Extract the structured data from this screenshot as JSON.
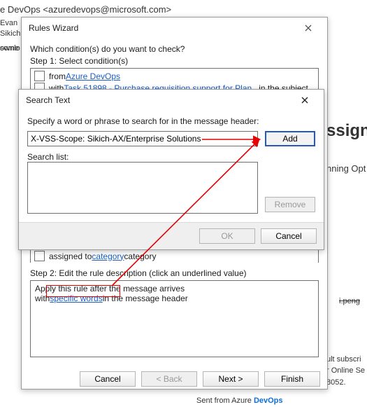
{
  "bg": {
    "from_line": "e DevOps <azuredevops@microsoft.com>",
    "evan": "Evan",
    "sikich": "Sikich",
    "ownlo": "ownlo",
    "some_pict": "some pict",
    "ssign": "ssign",
    "nning_opt": "nning Opt",
    "peng": "i.peng",
    "ult_subscri": "ult subscri",
    "online_se": "r Online Se",
    "num": "8052.",
    "sent_from_azure": "Sent from Azure ",
    "devops": "DevOps"
  },
  "rules": {
    "title": "Rules Wizard",
    "q": "Which condition(s) do you want to check?",
    "step1": "Step 1: Select condition(s)",
    "from_prefix": "from ",
    "from_link": "Azure DevOps",
    "with_prefix": "with ",
    "with_link": "Task 51898 - Purchase requisition support for Plan...",
    "with_suffix": " in the subject",
    "assigned_prefix": "assigned to ",
    "assigned_link": "category",
    "assigned_suffix": " category",
    "step2": "Step 2: Edit the rule description (click an underlined value)",
    "desc_l1": "Apply this rule after the message arrives",
    "desc_l2a": "with ",
    "desc_l2b": "specific words",
    "desc_l2c": " in the message header",
    "cancel": "Cancel",
    "back": "< Back",
    "next": "Next >",
    "finish": "Finish"
  },
  "search": {
    "title": "Search Text",
    "prompt": "Specify a word or phrase to search for in the message header:",
    "input_value": "X-VSS-Scope: Sikich-AX/Enterprise Solutions",
    "add": "Add",
    "list_label": "Search list:",
    "remove": "Remove",
    "ok": "OK",
    "cancel": "Cancel"
  }
}
